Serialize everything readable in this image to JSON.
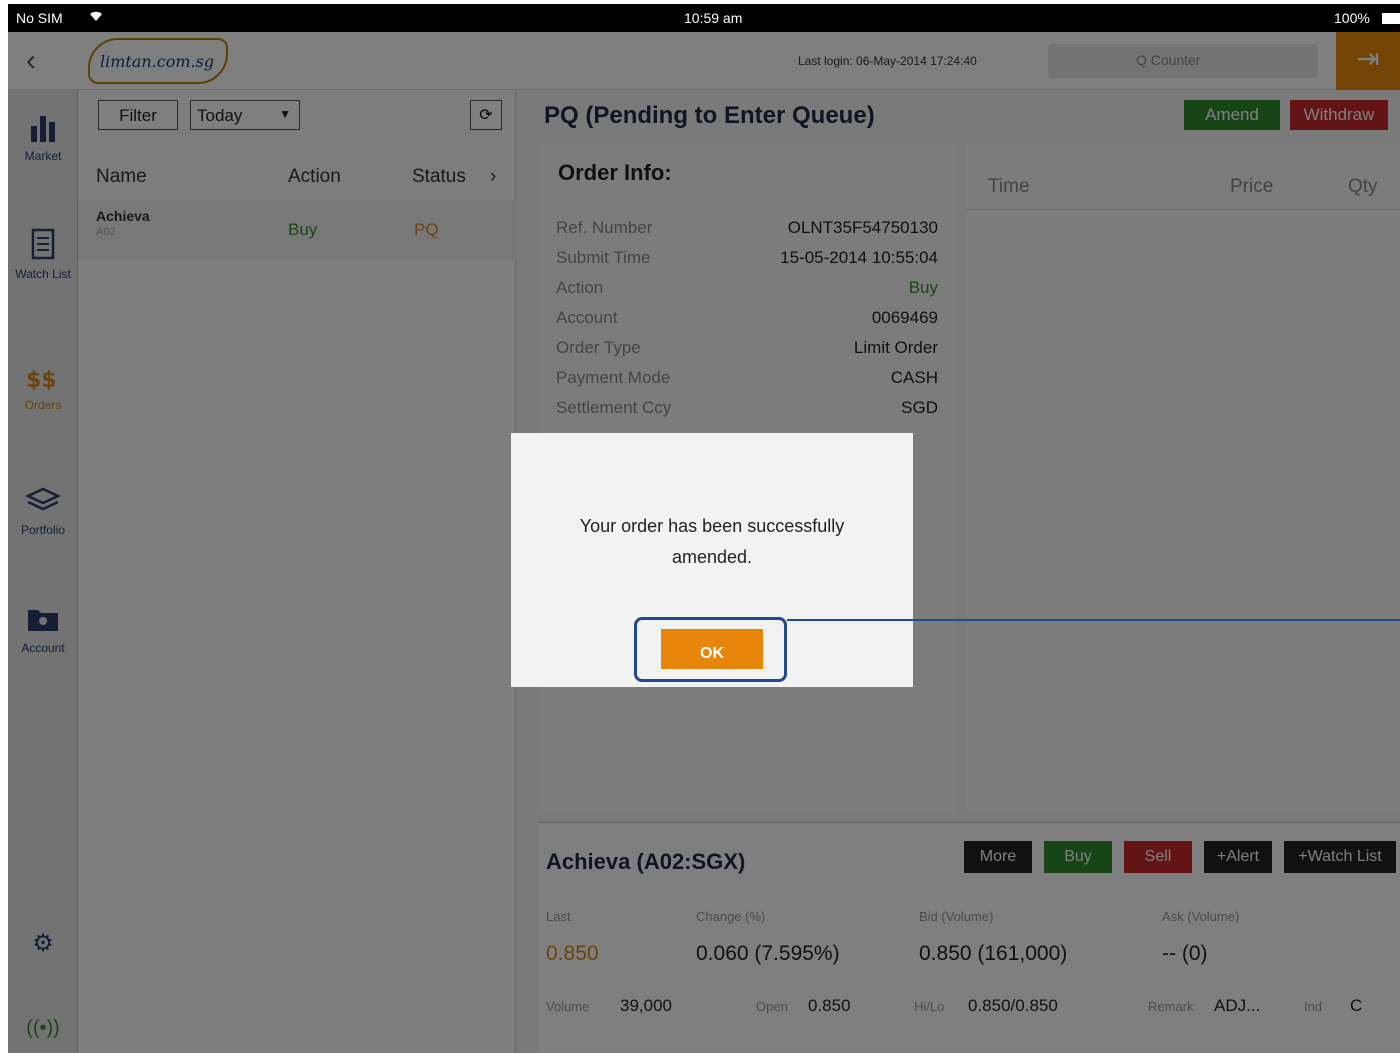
{
  "statusbar": {
    "carrier": "No SIM",
    "time": "10:59 am",
    "battery": "100%"
  },
  "header": {
    "logo": "limtan.com.sg",
    "last_login": "Last login: 06-May-2014 17:24:40",
    "search_placeholder": "Q Counter"
  },
  "sidebar": {
    "items": [
      {
        "label": "Market",
        "icon": "bar-chart-icon"
      },
      {
        "label": "Watch List",
        "icon": "list-icon"
      },
      {
        "label": "Orders",
        "icon": "orders-icon"
      },
      {
        "label": "Portfolio",
        "icon": "stack-icon"
      },
      {
        "label": "Account",
        "icon": "folder-icon"
      }
    ]
  },
  "orders_list": {
    "filter_label": "Filter",
    "date_filter": "Today",
    "columns": {
      "name": "Name",
      "action": "Action",
      "status": "Status"
    },
    "rows": [
      {
        "name": "Achieva",
        "code": "A02",
        "action": "Buy",
        "status": "PQ"
      }
    ]
  },
  "detail": {
    "title": "PQ (Pending to Enter Queue)",
    "amend_label": "Amend",
    "withdraw_label": "Withdraw",
    "order_info_title": "Order Info:",
    "fields": [
      {
        "key": "Ref. Number",
        "value": "OLNT35F54750130"
      },
      {
        "key": "Submit Time",
        "value": "15-05-2014 10:55:04"
      },
      {
        "key": "Action",
        "value": "Buy"
      },
      {
        "key": "Account",
        "value": "0069469"
      },
      {
        "key": "Order Type",
        "value": "Limit Order"
      },
      {
        "key": "Payment Mode",
        "value": "CASH"
      },
      {
        "key": "Settlement Ccy",
        "value": "SGD"
      }
    ],
    "trade_columns": {
      "time": "Time",
      "price": "Price",
      "qty": "Qty"
    }
  },
  "stock": {
    "title": "Achieva (A02:SGX)",
    "buttons": {
      "more": "More",
      "buy": "Buy",
      "sell": "Sell",
      "alert": "+Alert",
      "watchlist": "+Watch List"
    },
    "last_label": "Last",
    "last_value": "0.850",
    "change_label": "Change (%)",
    "change_value": "0.060 (7.595%)",
    "bid_label": "Bid (Volume)",
    "bid_value": "0.850 (161,000)",
    "ask_label": "Ask (Volume)",
    "ask_value": "-- (0)",
    "volume_label": "Volume",
    "volume_value": "39,000",
    "open_label": "Open",
    "open_value": "0.850",
    "hilo_label": "Hi/Lo",
    "hilo_value": "0.850/0.850",
    "remark_label": "Remark",
    "remark_value": "ADJ...",
    "ind_label": "Ind",
    "ind_value": "C"
  },
  "dialog": {
    "message_line1": "Your order has been successfully",
    "message_line2": "amended.",
    "ok_label": "OK"
  }
}
